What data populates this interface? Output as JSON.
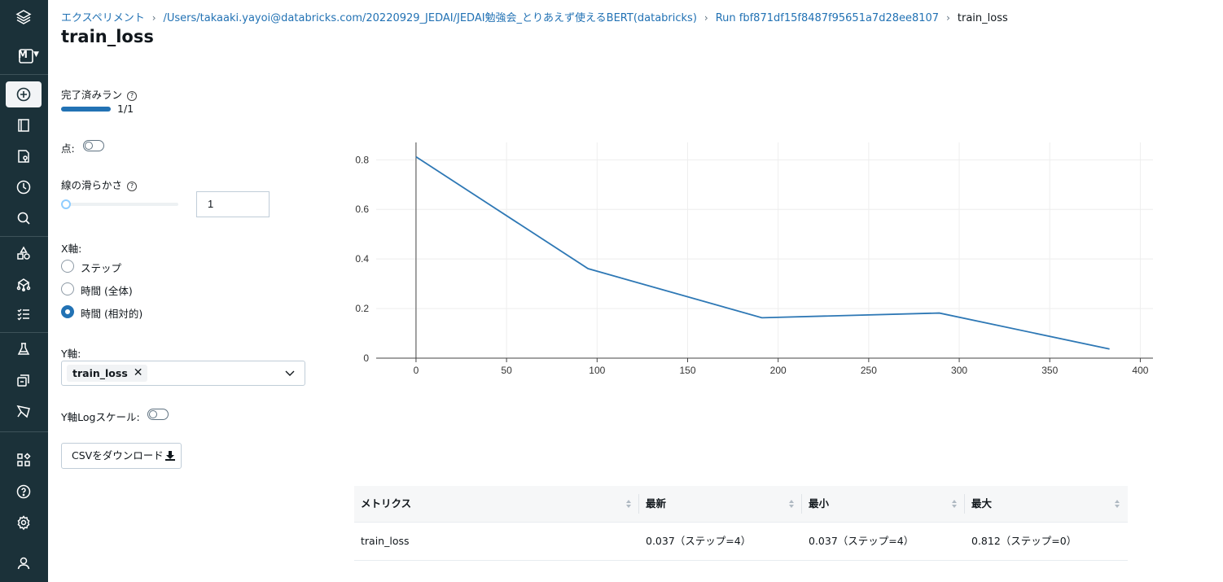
{
  "breadcrumb": {
    "experiments": "エクスペリメント",
    "path": "/Users/takaaki.yayoi@databricks.com/20220929_JEDAI/JEDAI勉強会_とりあえず使えるBERT(databricks)",
    "run": "Run fbf871df15f8487f95651a7d28ee8107",
    "current": "train_loss",
    "separator": "›"
  },
  "page_title": "train_loss",
  "sidebar": {
    "workspace_letter": "M",
    "items": [
      "logo-icon",
      "workspace-switcher-icon",
      "new-icon",
      "workspace-icon",
      "repos-icon",
      "recents-icon",
      "search-icon",
      "data-icon",
      "compute-icon",
      "workflows-icon",
      "experiments-icon",
      "feature-store-icon",
      "models-icon",
      "partner-connect-icon",
      "help-icon",
      "settings-icon",
      "user-icon"
    ]
  },
  "controls": {
    "completed_runs_label": "完了済みラン",
    "completed_runs_value": "1/1",
    "completed_runs_fraction": 1.0,
    "points_label": "点:",
    "points_enabled": false,
    "smoothness_label": "線の滑らかさ",
    "smoothness_value": "1",
    "x_axis_label": "X軸:",
    "x_axis_options": [
      "ステップ",
      "時間 (全体)",
      "時間 (相対的)"
    ],
    "x_axis_selected": 2,
    "y_axis_label": "Y軸:",
    "y_axis_tag": "train_loss",
    "y_log_label": "Y軸Logスケール:",
    "y_log_enabled": false,
    "download_label": "CSVをダウンロード"
  },
  "chart_data": {
    "type": "line",
    "x": [
      0,
      95,
      191,
      289,
      383
    ],
    "series": [
      {
        "values": [
          0.812,
          0.361,
          0.163,
          0.182,
          0.037
        ]
      }
    ],
    "xticks": [
      0,
      50,
      100,
      150,
      200,
      250,
      300,
      350,
      400
    ],
    "yticks": [
      0,
      0.2,
      0.4,
      0.6,
      0.8
    ],
    "ytick_labels": [
      "0",
      "0.2",
      "0.4",
      "0.6",
      "0.8"
    ],
    "xlim": [
      -22,
      407
    ],
    "ylim": [
      0,
      0.87
    ],
    "grid": true,
    "line_color": "#2e78b5"
  },
  "table": {
    "headers": [
      "メトリクス",
      "最新",
      "最小",
      "最大"
    ],
    "rows": [
      [
        "train_loss",
        "0.037（ステップ=4）",
        "0.037（ステップ=4）",
        "0.812（ステップ=0）"
      ]
    ]
  }
}
